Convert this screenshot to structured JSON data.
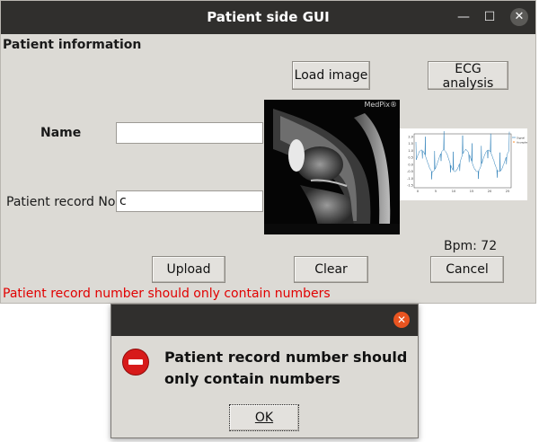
{
  "window": {
    "title": "Patient side GUI",
    "min_glyph": "—",
    "max_glyph": "☐",
    "close_glyph": "✕"
  },
  "form": {
    "section_label": "Patient information",
    "name_label": "Name",
    "name_value": "",
    "record_label": "Patient record No.",
    "record_value": "c"
  },
  "buttons": {
    "load_image": "Load image",
    "ecg_analysis": "ECG analysis",
    "upload": "Upload",
    "clear": "Clear",
    "cancel": "Cancel"
  },
  "image": {
    "watermark": "MedPix®"
  },
  "ecg": {
    "bpm_label": "Bpm: 72",
    "legend": [
      "Signal",
      "Accepted peaks"
    ],
    "y_ticks": [
      "2.0",
      "1.5",
      "1.0",
      "0.5",
      "0.0",
      "-0.5",
      "-1.0",
      "-1.5"
    ],
    "x_ticks": [
      "0",
      "5",
      "10",
      "15",
      "20",
      "25"
    ],
    "signal_color": "#1f77b4"
  },
  "error": {
    "message": "Patient record number should only contain numbers",
    "color": "#e10000"
  },
  "dialog": {
    "message": "Patient record number should only contain numbers",
    "ok_label": "OK",
    "close_glyph": "✕",
    "icon": "error-icon"
  }
}
